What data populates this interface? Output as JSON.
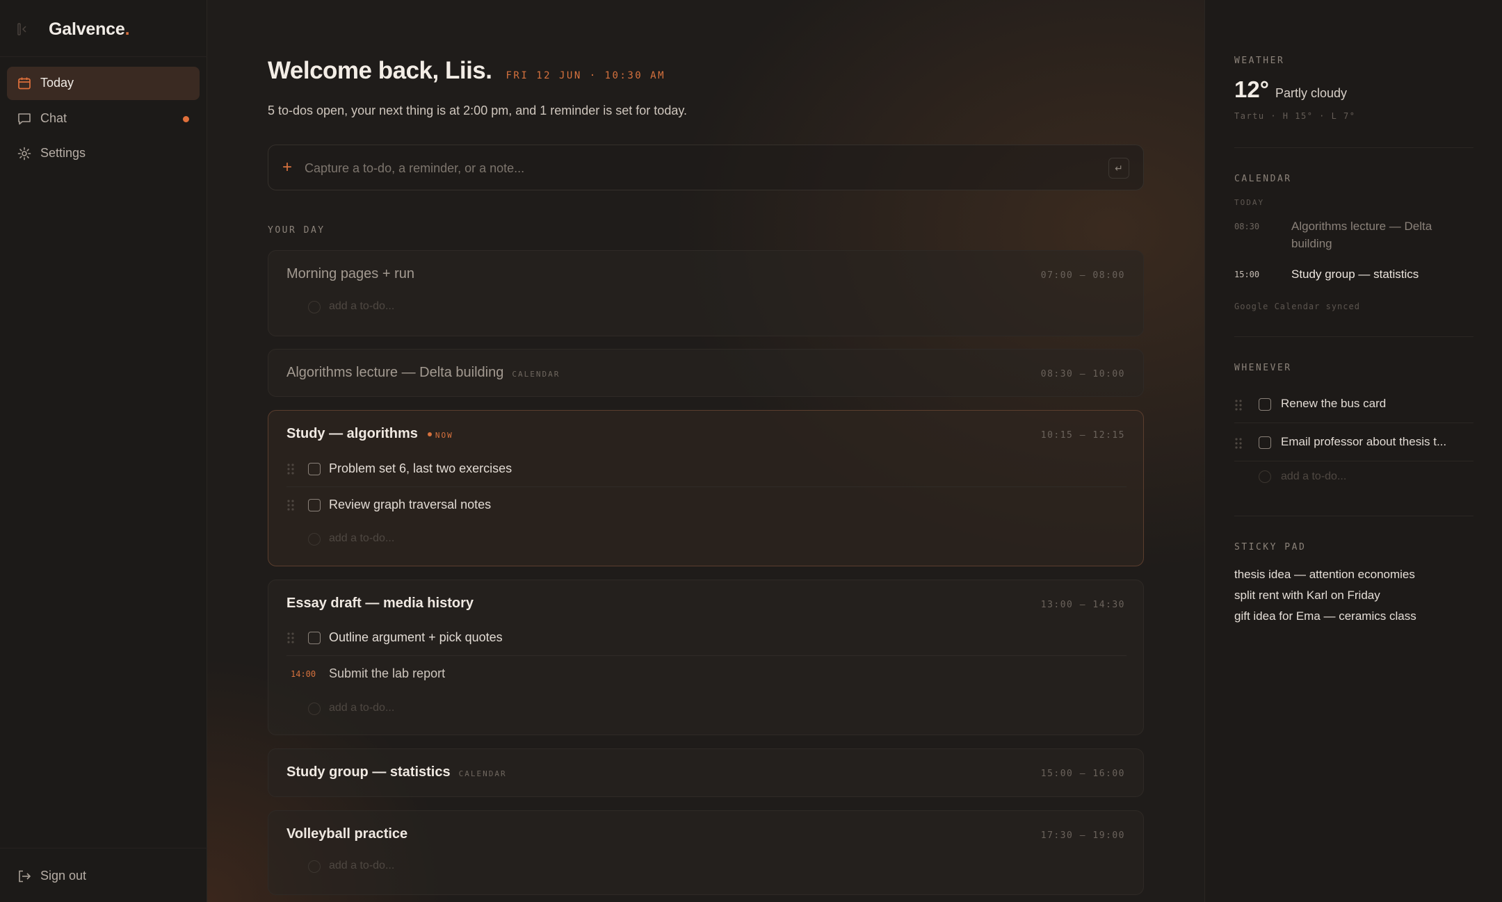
{
  "brand": {
    "name": "Galvence",
    "dot": "."
  },
  "nav": {
    "items": [
      {
        "label": "Today",
        "icon": "calendar-icon",
        "active": true
      },
      {
        "label": "Chat",
        "icon": "chat-icon",
        "unread": true
      },
      {
        "label": "Settings",
        "icon": "gear-icon"
      }
    ],
    "sign_out": "Sign out"
  },
  "header": {
    "greeting": "Welcome back, Liis.",
    "datetime": "FRI 12 JUN · 10:30 AM",
    "summary": "5 to-dos open, your next thing is at 2:00 pm, and 1 reminder is set for today."
  },
  "capture": {
    "placeholder": "Capture a to-do, a reminder, or a note...",
    "plus": "+",
    "enter": "↵"
  },
  "day": {
    "label": "YOUR DAY",
    "add_placeholder": "add a to-do...",
    "blocks": [
      {
        "title": "Morning pages + run",
        "time": "07:00 – 08:00"
      },
      {
        "title": "Algorithms lecture — Delta building",
        "tag": "CALENDAR",
        "time": "08:30 – 10:00"
      },
      {
        "title": "Study — algorithms",
        "now": "NOW",
        "time": "10:15 – 12:15",
        "todos": [
          "Problem set 6, last two exercises",
          "Review graph traversal notes"
        ]
      },
      {
        "title": "Essay draft — media history",
        "time": "13:00 – 14:30",
        "todos": [
          "Outline argument + pick quotes"
        ],
        "reminder": {
          "at": "14:00",
          "text": "Submit the lab report"
        }
      },
      {
        "title": "Study group — statistics",
        "tag": "CALENDAR",
        "time": "15:00 – 16:00"
      },
      {
        "title": "Volleyball practice",
        "time": "17:30 – 19:00"
      }
    ]
  },
  "weather": {
    "label": "WEATHER",
    "temp": "12°",
    "condition": "Partly cloudy",
    "meta": "Tartu · H 15° · L 7°"
  },
  "calendar": {
    "label": "CALENDAR",
    "today_label": "TODAY",
    "events": [
      {
        "time": "08:30",
        "name": "Algorithms lecture — Delta building"
      },
      {
        "time": "15:00",
        "name": "Study group — statistics"
      }
    ],
    "synced": "Google Calendar synced"
  },
  "whenever": {
    "label": "WHENEVER",
    "items": [
      "Renew the bus card",
      "Email professor about thesis t..."
    ],
    "add_placeholder": "add a to-do..."
  },
  "sticky": {
    "label": "STICKY PAD",
    "lines": [
      "thesis idea — attention economies",
      "split rent with Karl on Friday",
      "gift idea for Ema — ceramics class"
    ]
  },
  "colors": {
    "accent": "#d7723e",
    "background": "#1f1c1a",
    "active_nav": "#3a2a22"
  }
}
